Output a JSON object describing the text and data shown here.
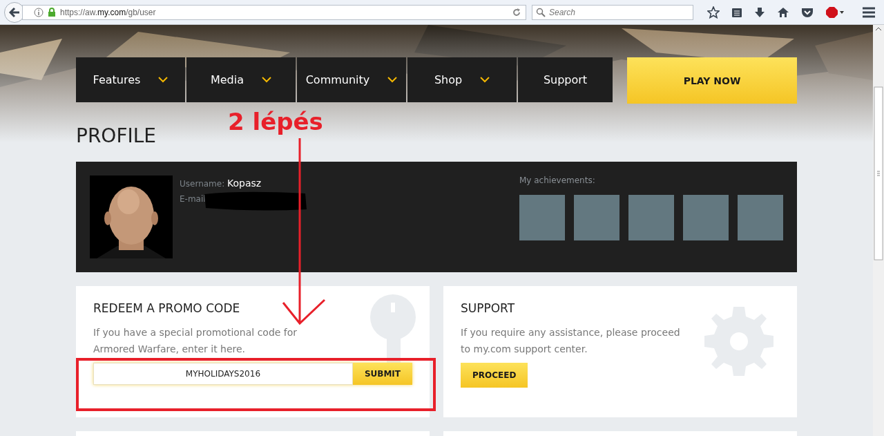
{
  "browser": {
    "url": "https://aw.**my.com**/gb/user",
    "search": {
      "placeholder": "Search"
    }
  },
  "nav": {
    "items": [
      {
        "label": "Features",
        "dropdown": true
      },
      {
        "label": "Media",
        "dropdown": true
      },
      {
        "label": "Community",
        "dropdown": true
      },
      {
        "label": "Shop",
        "dropdown": true
      },
      {
        "label": "Support",
        "dropdown": false
      }
    ],
    "cta": "PLAY NOW"
  },
  "page_title": "PROFILE",
  "profile": {
    "username_label": "Username:",
    "username": "Kopasz",
    "email_label": "E-mail",
    "email_redacted": true,
    "achievements_label": "My achievements:",
    "achievements": [
      {
        "unlocked": false
      },
      {
        "unlocked": false
      },
      {
        "unlocked": false
      },
      {
        "unlocked": false
      },
      {
        "unlocked": false
      }
    ]
  },
  "promo": {
    "title": "REDEEM A PROMO CODE",
    "text": "If you have a special promotional code for Armored Warfare, enter it here.",
    "code": "MYHOLIDAYS2016",
    "button": "SUBMIT"
  },
  "support": {
    "title": "SUPPORT",
    "text": "If you require any assistance, please proceed to my.com support center.",
    "button": "PROCEED"
  },
  "annotation": {
    "label": "2 lépés"
  }
}
